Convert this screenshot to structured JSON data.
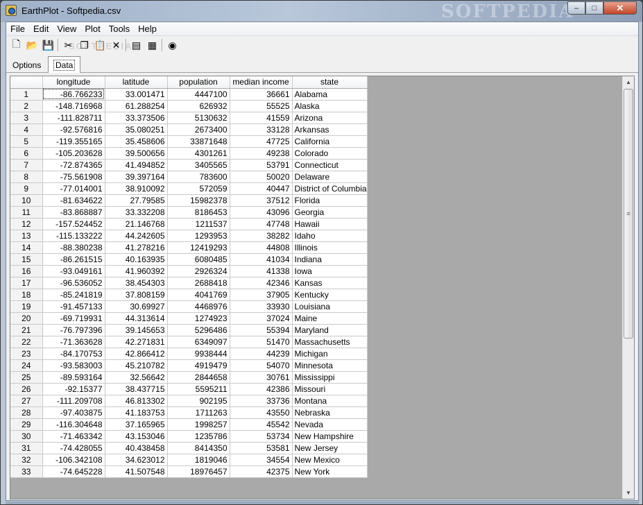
{
  "window": {
    "title": "EarthPlot - Softpedia.csv",
    "watermark": "SOFTPEDIA",
    "minimize": "–",
    "maximize": "□",
    "close": "✕"
  },
  "menu": [
    "File",
    "Edit",
    "View",
    "Plot",
    "Tools",
    "Help"
  ],
  "toolbar": {
    "watermark": "SOFTPEDIA",
    "buttons": [
      {
        "name": "new-file-icon",
        "glyph": "🗋"
      },
      {
        "name": "open-folder-icon",
        "glyph": "📂"
      },
      {
        "name": "save-icon",
        "glyph": "💾"
      },
      {
        "name": "cut-icon",
        "glyph": "✂"
      },
      {
        "name": "copy-icon",
        "glyph": "❐"
      },
      {
        "name": "paste-icon",
        "glyph": "📋"
      },
      {
        "name": "delete-icon",
        "glyph": "✕"
      },
      {
        "name": "data-import-icon",
        "glyph": "▤"
      },
      {
        "name": "table-edit-icon",
        "glyph": "▦"
      },
      {
        "name": "globe-icon",
        "glyph": "◉"
      }
    ]
  },
  "tabs": {
    "options": "Options",
    "data": "Data"
  },
  "grid": {
    "columns": [
      "longitude",
      "latitude",
      "population",
      "median income",
      "state"
    ],
    "rows": [
      [
        "1",
        "-86.766233",
        "33.001471",
        "4447100",
        "36661",
        "Alabama"
      ],
      [
        "2",
        "-148.716968",
        "61.288254",
        "626932",
        "55525",
        "Alaska"
      ],
      [
        "3",
        "-111.828711",
        "33.373506",
        "5130632",
        "41559",
        "Arizona"
      ],
      [
        "4",
        "-92.576816",
        "35.080251",
        "2673400",
        "33128",
        "Arkansas"
      ],
      [
        "5",
        "-119.355165",
        "35.458606",
        "33871648",
        "47725",
        "California"
      ],
      [
        "6",
        "-105.203628",
        "39.500656",
        "4301261",
        "49238",
        "Colorado"
      ],
      [
        "7",
        "-72.874365",
        "41.494852",
        "3405565",
        "53791",
        "Connecticut"
      ],
      [
        "8",
        "-75.561908",
        "39.397164",
        "783600",
        "50020",
        "Delaware"
      ],
      [
        "9",
        "-77.014001",
        "38.910092",
        "572059",
        "40447",
        "District of Columbia"
      ],
      [
        "10",
        "-81.634622",
        "27.79585",
        "15982378",
        "37512",
        "Florida"
      ],
      [
        "11",
        "-83.868887",
        "33.332208",
        "8186453",
        "43096",
        "Georgia"
      ],
      [
        "12",
        "-157.524452",
        "21.146768",
        "1211537",
        "47748",
        "Hawaii"
      ],
      [
        "13",
        "-115.133222",
        "44.242605",
        "1293953",
        "38282",
        "Idaho"
      ],
      [
        "14",
        "-88.380238",
        "41.278216",
        "12419293",
        "44808",
        "Illinois"
      ],
      [
        "15",
        "-86.261515",
        "40.163935",
        "6080485",
        "41034",
        "Indiana"
      ],
      [
        "16",
        "-93.049161",
        "41.960392",
        "2926324",
        "41338",
        "Iowa"
      ],
      [
        "17",
        "-96.536052",
        "38.454303",
        "2688418",
        "42346",
        "Kansas"
      ],
      [
        "18",
        "-85.241819",
        "37.808159",
        "4041769",
        "37905",
        "Kentucky"
      ],
      [
        "19",
        "-91.457133",
        "30.69927",
        "4468976",
        "33930",
        "Louisiana"
      ],
      [
        "20",
        "-69.719931",
        "44.313614",
        "1274923",
        "37024",
        "Maine"
      ],
      [
        "21",
        "-76.797396",
        "39.145653",
        "5296486",
        "55394",
        "Maryland"
      ],
      [
        "22",
        "-71.363628",
        "42.271831",
        "6349097",
        "51470",
        "Massachusetts"
      ],
      [
        "23",
        "-84.170753",
        "42.866412",
        "9938444",
        "44239",
        "Michigan"
      ],
      [
        "24",
        "-93.583003",
        "45.210782",
        "4919479",
        "54070",
        "Minnesota"
      ],
      [
        "25",
        "-89.593164",
        "32.56642",
        "2844658",
        "30761",
        "Mississippi"
      ],
      [
        "26",
        "-92.15377",
        "38.437715",
        "5595211",
        "42386",
        "Missouri"
      ],
      [
        "27",
        "-111.209708",
        "46.813302",
        "902195",
        "33736",
        "Montana"
      ],
      [
        "28",
        "-97.403875",
        "41.183753",
        "1711263",
        "43550",
        "Nebraska"
      ],
      [
        "29",
        "-116.304648",
        "37.165965",
        "1998257",
        "45542",
        "Nevada"
      ],
      [
        "30",
        "-71.463342",
        "43.153046",
        "1235786",
        "53734",
        "New Hampshire"
      ],
      [
        "31",
        "-74.428055",
        "40.438458",
        "8414350",
        "53581",
        "New Jersey"
      ],
      [
        "32",
        "-106.342108",
        "34.623012",
        "1819046",
        "34554",
        "New Mexico"
      ],
      [
        "33",
        "-74.645228",
        "41.507548",
        "18976457",
        "42375",
        "New York"
      ]
    ]
  },
  "scrollbar": {
    "up": "▲",
    "down": "▼",
    "grip": "≡"
  }
}
